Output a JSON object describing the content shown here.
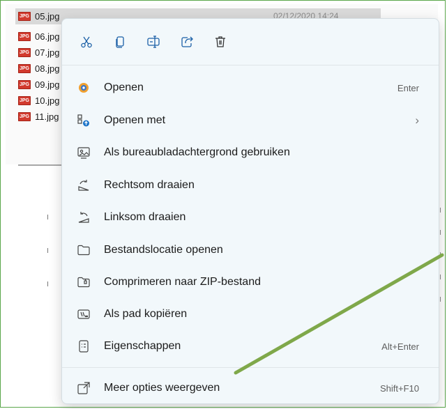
{
  "files": [
    {
      "name": "05.jpg",
      "date": "02/12/2020 14:24",
      "selected": true
    },
    {
      "name": "06.jpg"
    },
    {
      "name": "07.jpg"
    },
    {
      "name": "08.jpg"
    },
    {
      "name": "09.jpg"
    },
    {
      "name": "10.jpg"
    },
    {
      "name": "11.jpg"
    }
  ],
  "file_badge": "JPG",
  "toolbar": {
    "buttons": [
      {
        "icon": "scissors-icon",
        "action": "cut"
      },
      {
        "icon": "copy-icon",
        "action": "copy"
      },
      {
        "icon": "rename-icon",
        "action": "rename"
      },
      {
        "icon": "share-icon",
        "action": "share"
      },
      {
        "icon": "trash-icon",
        "action": "delete"
      }
    ]
  },
  "menu": {
    "items": [
      {
        "label": "Openen",
        "shortcut": "Enter",
        "icon": "photos-app-icon"
      },
      {
        "label": "Openen met",
        "shortcut": "›",
        "icon": "open-with-icon"
      },
      {
        "label": "Als bureaubladachtergrond gebruiken",
        "shortcut": "",
        "icon": "desktop-background-icon"
      },
      {
        "label": "Rechtsom draaien",
        "shortcut": "",
        "icon": "rotate-right-icon"
      },
      {
        "label": "Linksom draaien",
        "shortcut": "",
        "icon": "rotate-left-icon"
      },
      {
        "label": "Bestandslocatie openen",
        "shortcut": "",
        "icon": "folder-icon"
      },
      {
        "label": "Comprimeren naar ZIP-bestand",
        "shortcut": "",
        "icon": "zip-folder-icon"
      },
      {
        "label": "Als pad kopiëren",
        "shortcut": "",
        "icon": "copy-path-icon"
      },
      {
        "label": "Eigenschappen",
        "shortcut": "Alt+Enter",
        "icon": "properties-icon"
      },
      {
        "label": "Meer opties weergeven",
        "shortcut": "Shift+F10",
        "icon": "more-options-icon"
      }
    ]
  },
  "colors": {
    "menu_background": "#f2f8fb",
    "annotation_arrow": "#7fa84a",
    "frame_border": "#5aa64a",
    "selected_row": "#d9d9d9"
  }
}
